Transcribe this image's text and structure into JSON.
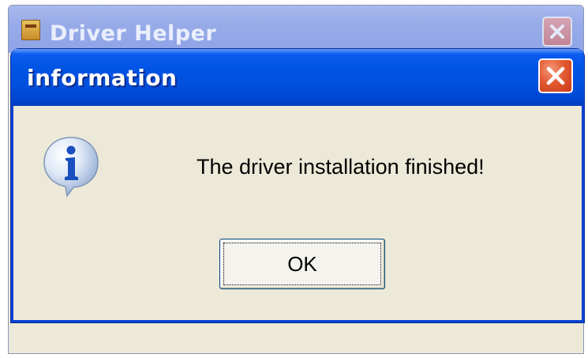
{
  "background_window": {
    "title": "Driver Helper"
  },
  "dialog": {
    "title": "information",
    "message": "The driver installation finished!",
    "ok_label": "OK",
    "icon": "info-icon"
  },
  "colors": {
    "titlebar_blue": "#0054e3",
    "close_red": "#e35b32",
    "dialog_bg": "#ece9d8"
  }
}
